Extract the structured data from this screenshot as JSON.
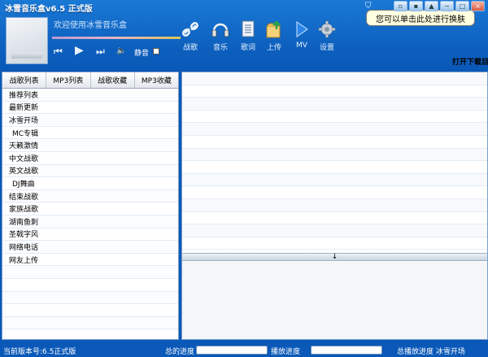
{
  "window": {
    "title": "冰雪音乐盒v6.5 正式版",
    "tooltip": "您可以单击此处进行换肤",
    "buttons": [
      "▫",
      "▪",
      "▲",
      "−",
      "□",
      "×"
    ]
  },
  "player": {
    "now_playing": "欢迎使用冰雪音乐盒",
    "controls": {
      "prev": "⏮",
      "play": "▶",
      "next": "⏭",
      "volume": "🔈"
    },
    "mute_label": "静音"
  },
  "toolbar": [
    {
      "label": "战歌",
      "icon": "link-icon"
    },
    {
      "label": "音乐",
      "icon": "headphones-icon"
    },
    {
      "label": "歌词",
      "icon": "document-icon"
    },
    {
      "label": "上传",
      "icon": "upload-icon"
    },
    {
      "label": "MV",
      "icon": "play-triangle-icon"
    },
    {
      "label": "设置",
      "icon": "gear-icon"
    }
  ],
  "open_download": "打开下载目",
  "tabs": [
    "战歌列表",
    "MP3列表",
    "战歌收藏",
    "MP3收藏"
  ],
  "categories": [
    "推荐列表",
    "最新更新",
    "冰雪开场",
    "MC专辑",
    "天籁激情",
    "中文战歌",
    "英文战歌",
    "DJ舞曲",
    "结束战歌",
    "家族战歌",
    "湖南鱼刺",
    "圣戟字风",
    "网络电话",
    "网友上传"
  ],
  "splitter_arrow": "↓",
  "status": {
    "version": "当前版本号:6.5正式版",
    "progress1_label": "总的进度",
    "progress2_label": "播放进度",
    "right_text": "总播放进度 冰雪开场"
  },
  "colors": {
    "accent": "#0d5fbd",
    "panel": "#ffffff",
    "tooltip": "#ffffe1"
  }
}
